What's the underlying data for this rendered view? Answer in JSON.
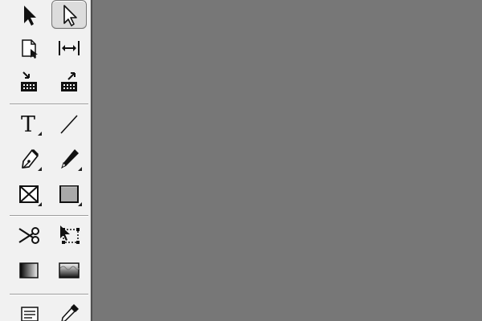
{
  "window": {
    "panel": "tools-panel",
    "canvas": "document-pasteboard"
  },
  "colors": {
    "toolbar_bg": "#f1f1f1",
    "canvas_bg": "#777777",
    "icon_stroke": "#111111",
    "active_bg": "#dcdcdc"
  },
  "tools": [
    {
      "name": "selection-tool",
      "icon": "black-arrow-icon",
      "active": false
    },
    {
      "name": "direct-selection-tool",
      "icon": "white-arrow-icon",
      "active": true
    },
    {
      "name": "page-tool",
      "icon": "page-icon",
      "active": false
    },
    {
      "name": "gap-tool",
      "icon": "gap-icon",
      "active": false
    },
    {
      "name": "content-collector-tool",
      "icon": "collector-icon",
      "active": false
    },
    {
      "name": "content-placer-tool",
      "icon": "placer-icon",
      "active": false
    },
    {
      "name": "type-tool",
      "icon": "type-icon",
      "active": false
    },
    {
      "name": "line-tool",
      "icon": "line-icon",
      "active": false
    },
    {
      "name": "pen-tool",
      "icon": "pen-icon",
      "active": false
    },
    {
      "name": "pencil-tool",
      "icon": "pencil-icon",
      "active": false
    },
    {
      "name": "rectangle-frame-tool",
      "icon": "frame-icon",
      "active": false
    },
    {
      "name": "rectangle-tool",
      "icon": "rectangle-icon",
      "active": false
    },
    {
      "name": "scissors-tool",
      "icon": "scissors-icon",
      "active": false
    },
    {
      "name": "free-transform-tool",
      "icon": "transform-icon",
      "active": false
    },
    {
      "name": "gradient-swatch-tool",
      "icon": "gradient-icon",
      "active": false
    },
    {
      "name": "gradient-feather-tool",
      "icon": "feather-icon",
      "active": false
    },
    {
      "name": "note-tool",
      "icon": "note-icon",
      "active": false
    },
    {
      "name": "eyedropper-tool",
      "icon": "eyedropper-icon",
      "active": false
    }
  ]
}
